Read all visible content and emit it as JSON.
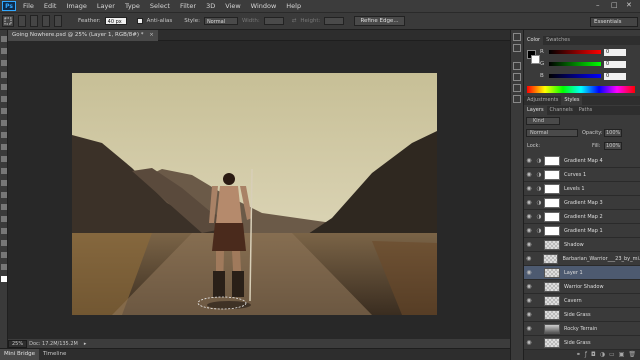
{
  "menu": [
    "File",
    "Edit",
    "Image",
    "Layer",
    "Type",
    "Select",
    "Filter",
    "3D",
    "View",
    "Window",
    "Help"
  ],
  "app_logo": "Ps",
  "window_controls": [
    "–",
    "□",
    "✕"
  ],
  "options_bar": {
    "feather_label": "Feather:",
    "feather_value": "40 px",
    "antialias_label": "Anti-alias",
    "style_label": "Style:",
    "style_value": "Normal",
    "width_label": "Width:",
    "height_label": "Height:",
    "refine_edge": "Refine Edge...",
    "workspace": "Essentials"
  },
  "document": {
    "tab_title": "Going Nowhere.psd @ 25% (Layer 1, RGB/8#) *",
    "close": "×"
  },
  "status": {
    "zoom": "25%",
    "doc_info": "Doc: 17.2M/135.2M"
  },
  "bottom_tabs": [
    "Mini Bridge",
    "Timeline"
  ],
  "color_panel": {
    "tabs": [
      "Color",
      "Swatches"
    ],
    "channels": [
      {
        "label": "R",
        "value": "0"
      },
      {
        "label": "G",
        "value": "0"
      },
      {
        "label": "B",
        "value": "0"
      }
    ]
  },
  "adjust_tabs": [
    "Adjustments",
    "Styles"
  ],
  "layers_panel": {
    "tabs": [
      "Layers",
      "Channels",
      "Paths"
    ],
    "kind_label": "Kind",
    "blend_mode": "Normal",
    "opacity_label": "Opacity:",
    "opacity_value": "100%",
    "lock_label": "Lock:",
    "fill_label": "Fill:",
    "fill_value": "100%",
    "layers": [
      {
        "name": "Gradient Map 4",
        "type": "adjustment"
      },
      {
        "name": "Curves 1",
        "type": "adjustment"
      },
      {
        "name": "Levels 1",
        "type": "adjustment"
      },
      {
        "name": "Gradient Map 3",
        "type": "adjustment"
      },
      {
        "name": "Gradient Map 2",
        "type": "adjustment"
      },
      {
        "name": "Gradient Map 1",
        "type": "adjustment"
      },
      {
        "name": "Shadow",
        "type": "pixel"
      },
      {
        "name": "Barbarian_Warrior___23_by_mi...",
        "type": "pixel"
      },
      {
        "name": "Layer 1",
        "type": "pixel",
        "selected": true
      },
      {
        "name": "Warrior Shadow",
        "type": "pixel"
      },
      {
        "name": "Cavern",
        "type": "pixel"
      },
      {
        "name": "Side Grass",
        "type": "pixel"
      },
      {
        "name": "Rocky Terrain",
        "type": "pixel"
      },
      {
        "name": "Side Grass",
        "type": "pixel"
      }
    ]
  },
  "colors": {
    "ui_bg": "#3a3a3a",
    "canvas_bg": "#282828",
    "selection": "#4d5a70"
  }
}
